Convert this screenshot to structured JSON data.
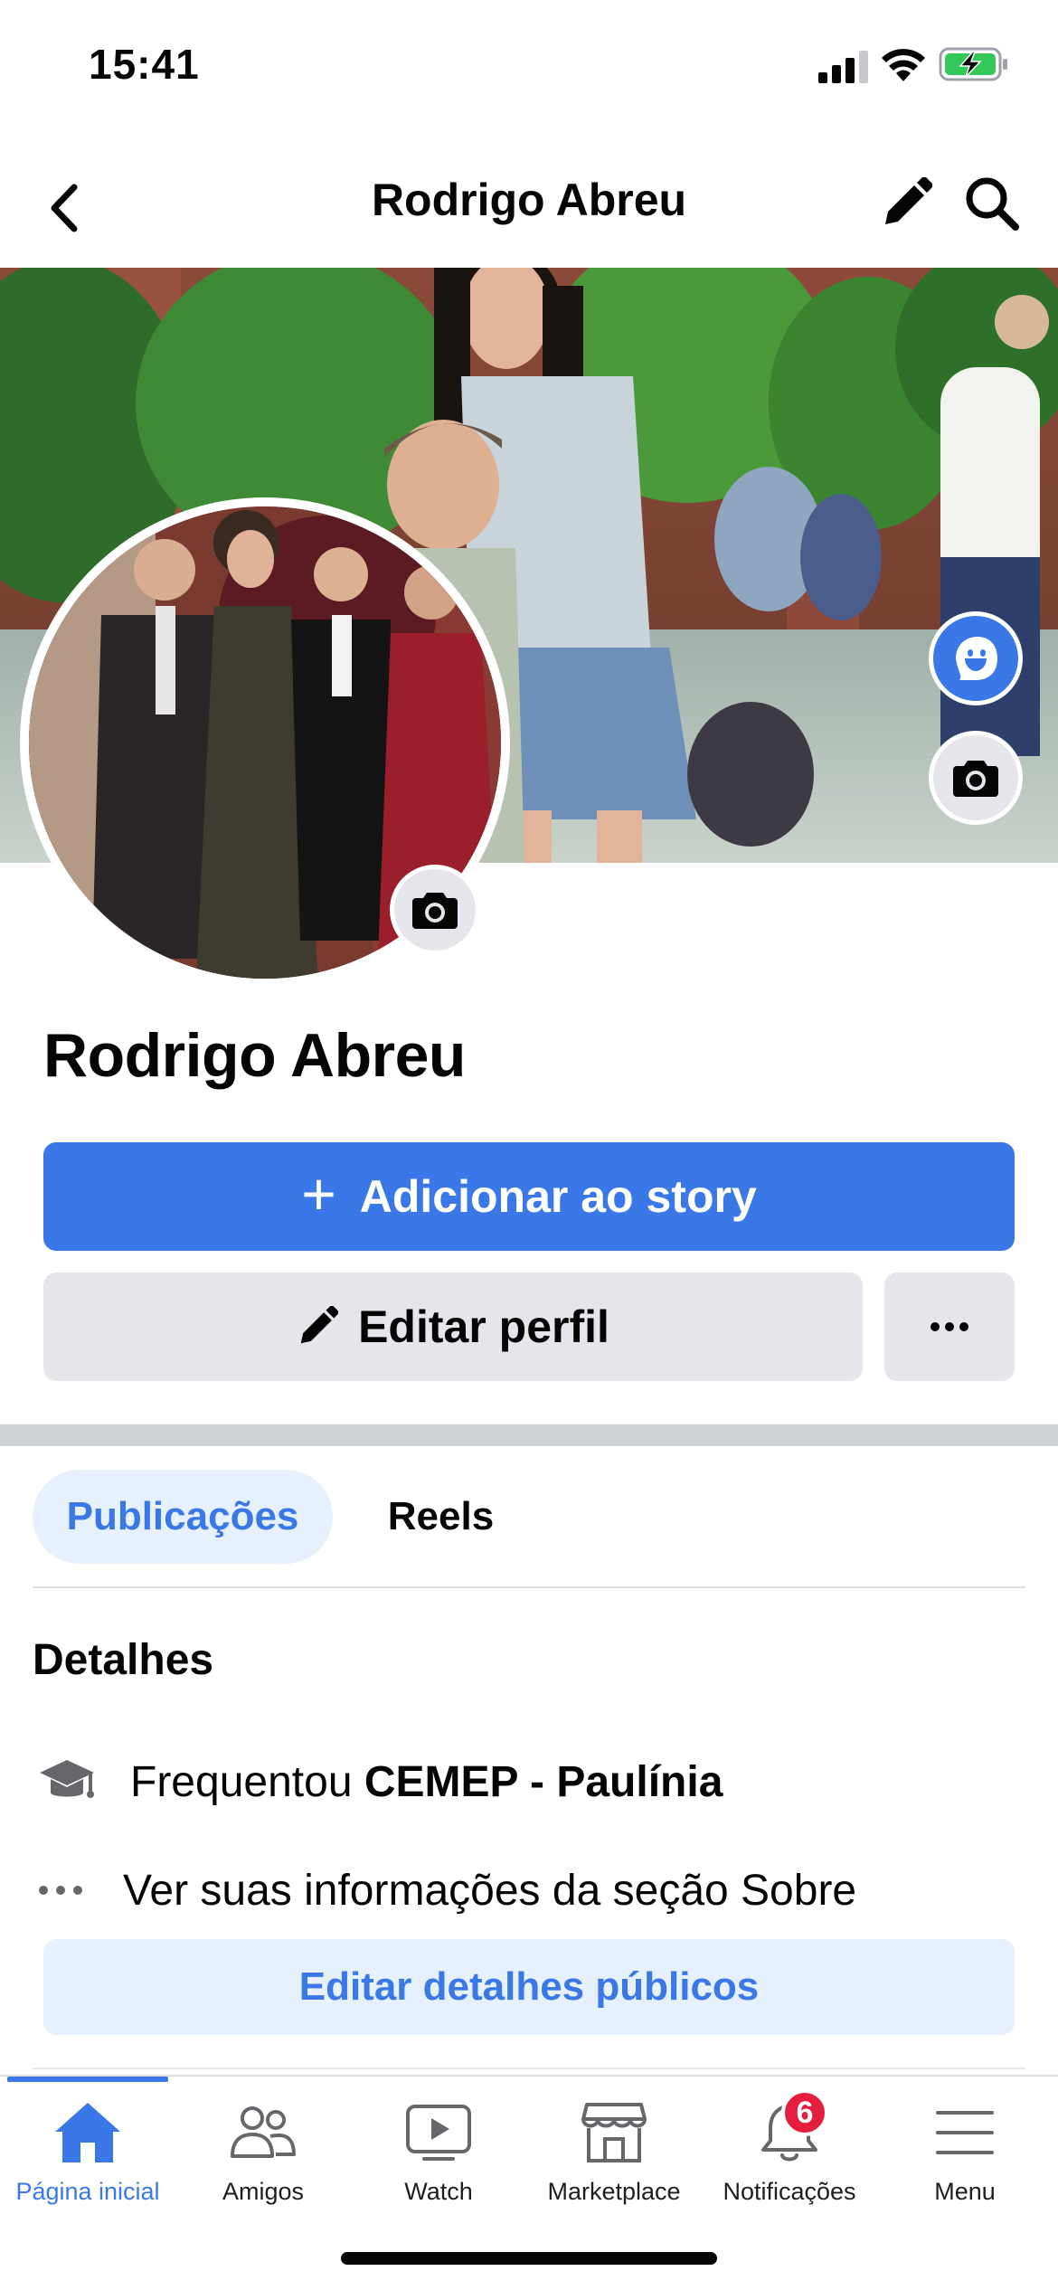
{
  "status_bar": {
    "time": "15:41"
  },
  "nav": {
    "title": "Rodrigo Abreu",
    "back_icon": "chevron-left-icon",
    "edit_icon": "pencil-icon",
    "search_icon": "search-icon"
  },
  "profile": {
    "name": "Rodrigo Abreu"
  },
  "actions": {
    "add_story_plus": "+",
    "add_story_label": "Adicionar ao story",
    "edit_profile_label": "Editar perfil",
    "more_icon": "more-horizontal-icon"
  },
  "tabs": [
    {
      "label": "Publicações",
      "active": true
    },
    {
      "label": "Reels",
      "active": false
    }
  ],
  "details": {
    "heading": "Detalhes",
    "school_prefix": "Frequentou ",
    "school_name": "CEMEP - Paulínia",
    "about_link": "Ver suas informações da seção Sobre",
    "edit_button": "Editar detalhes públicos"
  },
  "tab_bar": {
    "items": [
      {
        "label": "Página inicial",
        "icon": "home-icon",
        "active": true
      },
      {
        "label": "Amigos",
        "icon": "friends-icon",
        "active": false
      },
      {
        "label": "Watch",
        "icon": "watch-icon",
        "active": false
      },
      {
        "label": "Marketplace",
        "icon": "marketplace-icon",
        "active": false
      },
      {
        "label": "Notificações",
        "icon": "bell-icon",
        "active": false,
        "badge": "6"
      },
      {
        "label": "Menu",
        "icon": "menu-icon",
        "active": false
      }
    ]
  },
  "colors": {
    "accent": "#3b78e7",
    "badge": "#e41e3f",
    "secondary_button": "#e4e6eb",
    "light_accent_bg": "#e7f0fd"
  }
}
